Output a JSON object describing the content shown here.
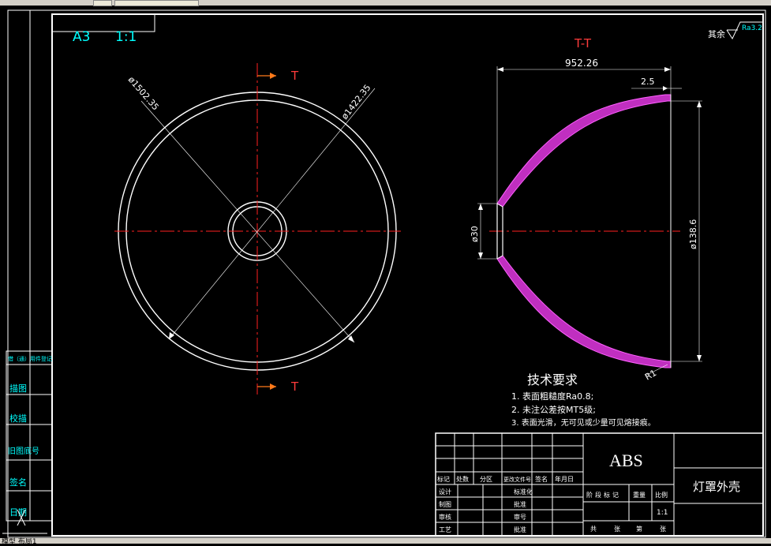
{
  "sheet": {
    "format": "A3",
    "scale": "1:1"
  },
  "section": {
    "label": "T-T",
    "marker": "T",
    "dim_width": "952.26",
    "dim_lip": "2.5",
    "dim_small_dia": "ø30",
    "dim_large_dia": "ø138.6",
    "fillet": "R1"
  },
  "front_view": {
    "dim_outer": "ø1502.35",
    "dim_inner": "ø1422.35"
  },
  "roughness": {
    "label": "其余",
    "value": "Ra3.2"
  },
  "tech_requirements": {
    "title": "技术要求",
    "items": [
      "1. 表面粗糙度Ra0.8;",
      "2. 未注公差按MT5级;",
      "3. 表面光滑，无可见或少量可见熔接痕。"
    ]
  },
  "side_labels": [
    "借（通）用件登记",
    "描图",
    "校描",
    "旧图底号",
    "签名",
    "日期"
  ],
  "title_block": {
    "material": "ABS",
    "part_name": "灯罩外壳",
    "header_row": [
      "标记",
      "处数",
      "分区",
      "更改文件号",
      "签名",
      "年月日"
    ],
    "row_labels": [
      "设计",
      "制图",
      "审核",
      "工艺"
    ],
    "mid_labels": [
      "标准化",
      "批准",
      "审号",
      "批准"
    ],
    "stage_headers": [
      "阶段标记",
      "重量",
      "比例"
    ],
    "scale_value": "1:1",
    "sheet_info": [
      "共",
      "张",
      "第",
      "张"
    ]
  },
  "status_bar": "模型 布局1"
}
